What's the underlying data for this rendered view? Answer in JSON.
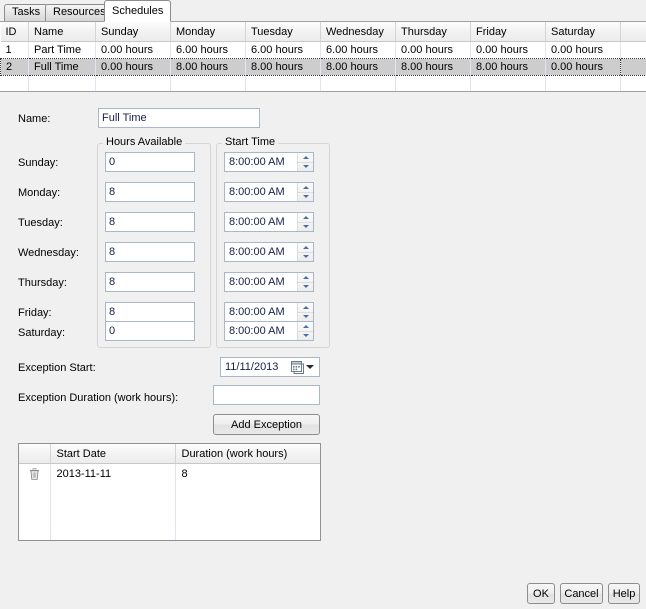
{
  "tabs": [
    {
      "label": "Tasks",
      "active": false
    },
    {
      "label": "Resources",
      "active": false
    },
    {
      "label": "Schedules",
      "active": true
    }
  ],
  "schedule_grid": {
    "columns": [
      "ID",
      "Name",
      "Sunday",
      "Monday",
      "Tuesday",
      "Wednesday",
      "Thursday",
      "Friday",
      "Saturday"
    ],
    "rows": [
      {
        "selected": false,
        "cells": [
          "1",
          "Part Time",
          "0.00 hours",
          "6.00 hours",
          "6.00 hours",
          "6.00 hours",
          "0.00 hours",
          "0.00 hours",
          "0.00 hours"
        ]
      },
      {
        "selected": true,
        "cells": [
          "2",
          "Full Time",
          "0.00 hours",
          "8.00 hours",
          "8.00 hours",
          "8.00 hours",
          "8.00 hours",
          "8.00 hours",
          "0.00 hours"
        ]
      }
    ]
  },
  "form": {
    "name_label": "Name:",
    "name_value": "Full Time",
    "hours_group_title": "Hours Available",
    "start_group_title": "Start Time",
    "days": [
      {
        "label": "Sunday:",
        "hours": "0",
        "start": "8:00:00 AM"
      },
      {
        "label": "Monday:",
        "hours": "8",
        "start": "8:00:00 AM"
      },
      {
        "label": "Tuesday:",
        "hours": "8",
        "start": "8:00:00 AM"
      },
      {
        "label": "Wednesday:",
        "hours": "8",
        "start": "8:00:00 AM"
      },
      {
        "label": "Thursday:",
        "hours": "8",
        "start": "8:00:00 AM"
      },
      {
        "label": "Friday:",
        "hours": "8",
        "start": "8:00:00 AM"
      },
      {
        "label": "Saturday:",
        "hours": "0",
        "start": "8:00:00 AM"
      }
    ]
  },
  "exception": {
    "start_label": "Exception Start:",
    "start_value": "11/11/2013",
    "duration_label": "Exception Duration (work hours):",
    "duration_value": "",
    "duration_placeholder": "",
    "add_button": "Add Exception",
    "list": {
      "columns": [
        "",
        "Start Date",
        "Duration (work hours)"
      ],
      "rows": [
        {
          "icon": "trash-icon",
          "start_date": "2013-11-11",
          "duration": "8"
        }
      ]
    }
  },
  "dialog_buttons": {
    "ok": "OK",
    "cancel": "Cancel",
    "help": "Help"
  },
  "colors": {
    "background": "#f0f0f0",
    "selection": "#cdcdcd",
    "field_border": "#a9b7c9",
    "text": "#000000",
    "spinner_arrow": "#4a6fa5"
  }
}
